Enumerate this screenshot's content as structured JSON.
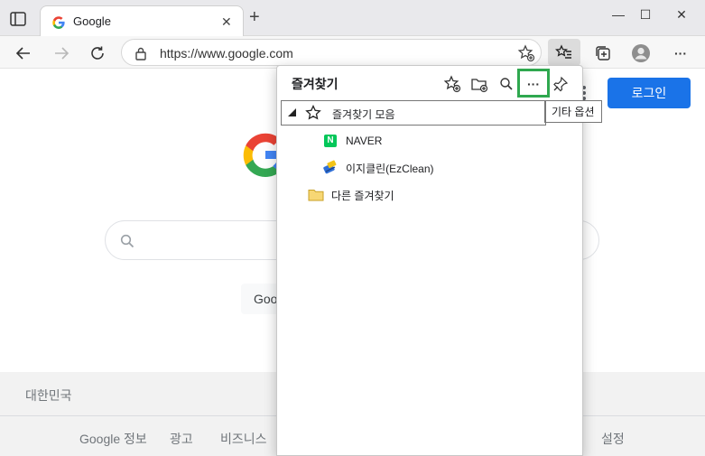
{
  "browser": {
    "tab": {
      "title": "Google",
      "close_glyph": "✕"
    },
    "new_tab_glyph": "+",
    "window_controls": {
      "minimize": "—",
      "maximize": "☐",
      "close": "✕"
    },
    "address": {
      "url": "https://www.google.com"
    },
    "more_glyph": "···"
  },
  "page": {
    "login_label": "로그인",
    "search_button_partial": "Goo",
    "footer": {
      "country": "대한민국",
      "links": [
        "Google 정보",
        "광고",
        "비즈니스",
        "설정"
      ]
    }
  },
  "favorites": {
    "title": "즐겨찾기",
    "more_glyph": "···",
    "tooltip": "기타 옵션",
    "tree": {
      "bar_label": "즐겨찾기 모음",
      "items": [
        {
          "label": "NAVER",
          "icon": "naver-icon"
        },
        {
          "label": "이지클린(EzClean)",
          "icon": "ezclean-icon"
        }
      ],
      "other_label": "다른 즐겨찾기"
    }
  },
  "colors": {
    "accent_blue": "#1a73e8",
    "highlight_green": "#2fa84f",
    "naver_green": "#03c75a"
  }
}
